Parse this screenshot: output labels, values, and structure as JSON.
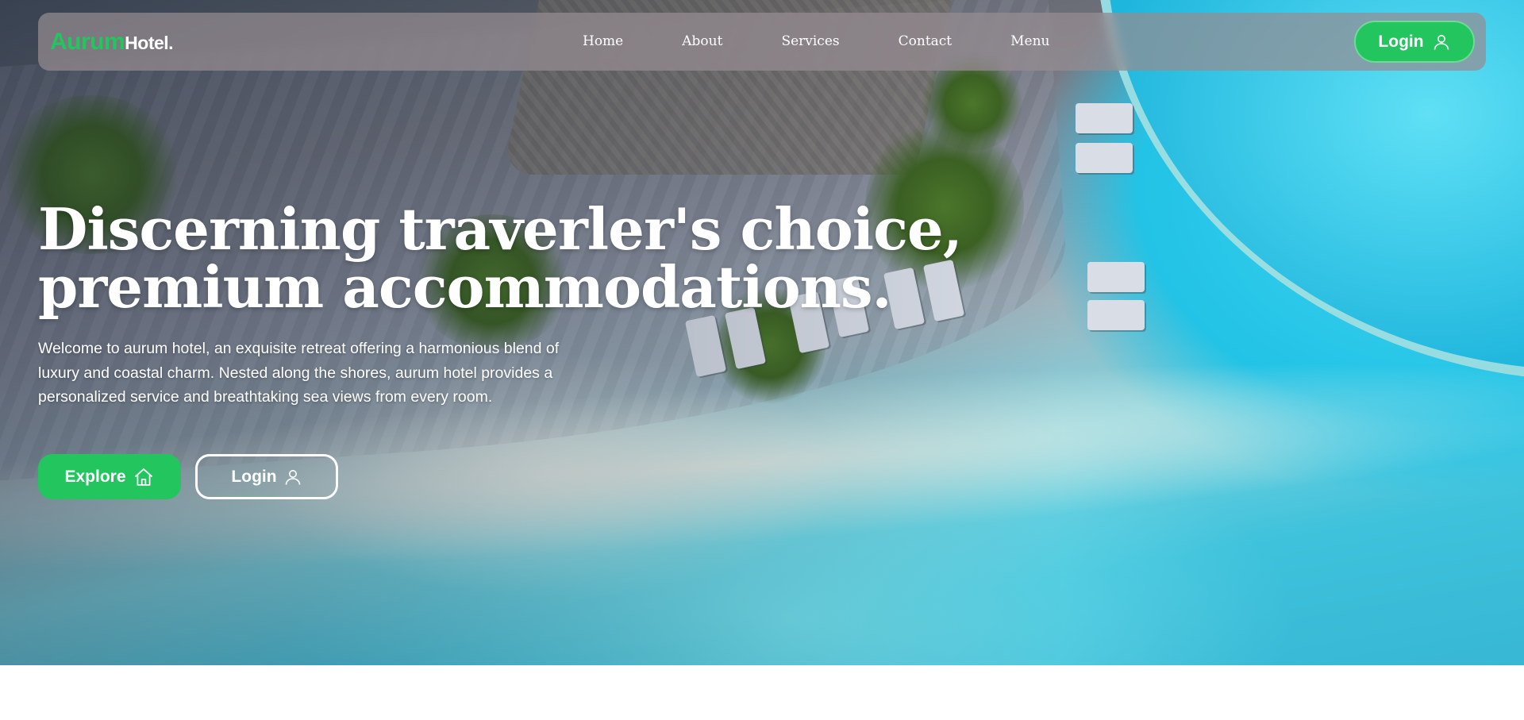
{
  "nav": {
    "logo_brand": "Aurum",
    "logo_word": "Hotel.",
    "links": [
      "Home",
      "About",
      "Services",
      "Contact",
      "Menu"
    ],
    "login_label": "Login"
  },
  "hero": {
    "headline_line1": "Discerning traverler's choice,",
    "headline_line2": "premium accommodations.",
    "intro": "Welcome to aurum hotel, an exquisite retreat offering a harmonious blend of luxury and coastal charm. Nested along the shores, aurum hotel provides a personalized service and breathtaking sea views from every room.",
    "explore_label": "Explore",
    "login_label": "Login"
  },
  "icons": {
    "login_top": "user-icon",
    "explore": "home-icon",
    "login_hero": "user-icon"
  },
  "colors": {
    "accent": "#22c55e",
    "text": "#ffffff"
  }
}
